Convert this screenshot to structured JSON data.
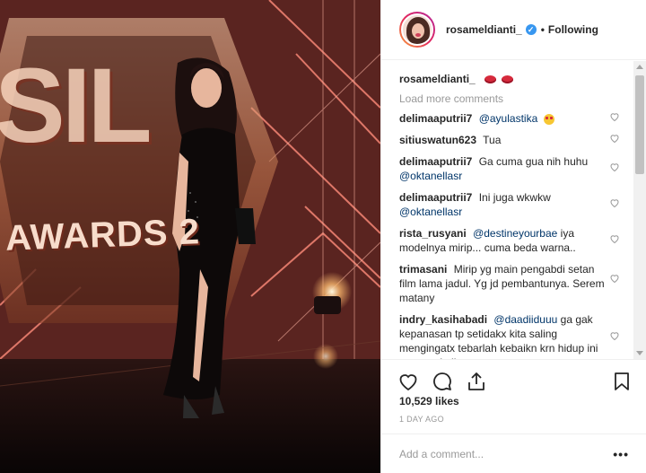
{
  "header": {
    "username": "rosameldianti_",
    "separator": "•",
    "follow_status": "Following"
  },
  "photo": {
    "backdrop_text": "AWARDS 2",
    "backdrop_big": "SIL"
  },
  "caption": {
    "username": "rosameldianti_"
  },
  "load_more": "Load more comments",
  "comments": [
    {
      "user": "delimaaputrii7",
      "mention": "@ayulastika",
      "text": ""
    },
    {
      "user": "sitiuswatun623",
      "mention": "",
      "text": "Tua"
    },
    {
      "user": "delimaaputrii7",
      "mention": "",
      "text": "Ga cuma gua nih huhu",
      "mention2": "@oktanellasr"
    },
    {
      "user": "delimaaputrii7",
      "mention": "",
      "text": "Ini juga wkwkw",
      "mention2": "@oktanellasr"
    },
    {
      "user": "rista_rusyani",
      "mention": "@destineyourbae",
      "text": "iya modelnya mirip... cuma beda warna.."
    },
    {
      "user": "trimasani",
      "mention": "",
      "text": "Mirip yg main pengabdi setan film lama jadul. Yg jd pembantunya. Serem matany"
    },
    {
      "user": "indry_kasihabadi",
      "mention": "@daadiiduuu",
      "text": "ga gak kepanasan tp setidakx kita saling mengingatx tebarlah kebaikn krn hidup ini cuma sekali say"
    }
  ],
  "likes": "10,529 likes",
  "timestamp": "1 DAY AGO",
  "add_comment": {
    "placeholder": "Add a comment...",
    "more": "•••"
  },
  "icons": [
    "heart-icon",
    "comment-icon",
    "share-icon",
    "bookmark-icon",
    "verified-badge-icon"
  ],
  "colors": {
    "accent": "#3897f0",
    "mention": "#003569",
    "muted": "#999999"
  }
}
